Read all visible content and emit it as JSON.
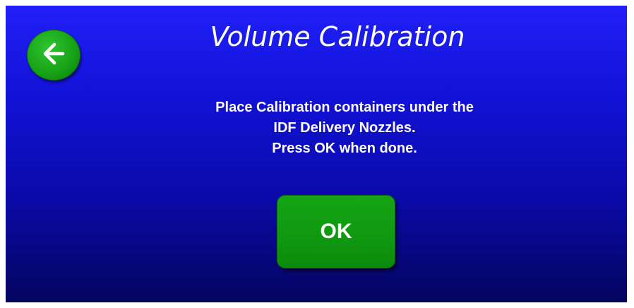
{
  "screen": {
    "title": "Volume Calibration",
    "back_icon": "arrow-left-icon",
    "message_lines": [
      "Place Calibration containers under the",
      "IDF Delivery Nozzles.",
      "Press OK when done."
    ],
    "ok_label": "OK"
  },
  "colors": {
    "background": "#1414d0",
    "button_green": "#10a010",
    "text": "#ffffff"
  }
}
